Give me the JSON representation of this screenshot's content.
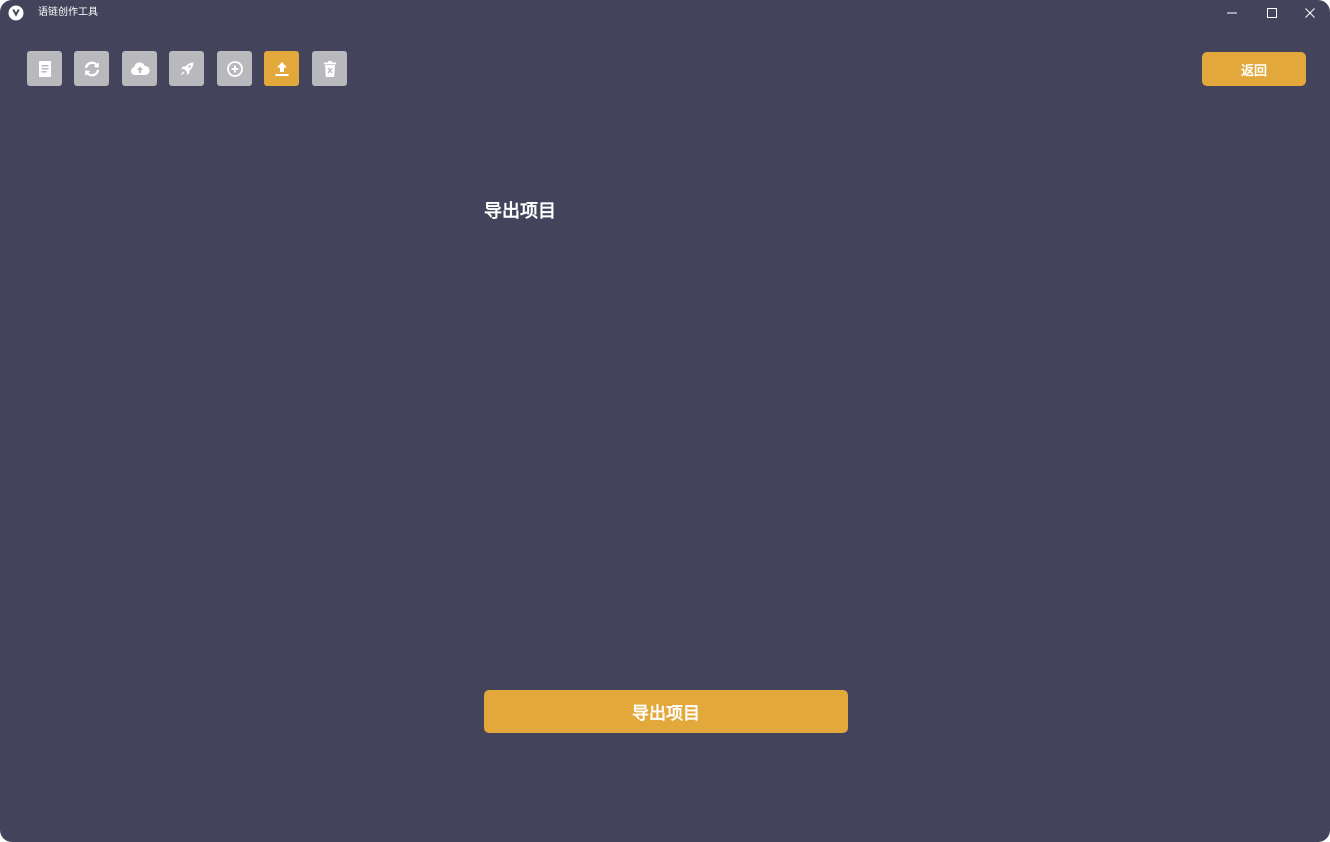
{
  "window": {
    "title": "语链创作工具"
  },
  "toolbar": {
    "tools": [
      {
        "name": "document",
        "icon": "document-icon",
        "active": false
      },
      {
        "name": "sync",
        "icon": "sync-icon",
        "active": false
      },
      {
        "name": "cloud-upload",
        "icon": "cloud-upload-icon",
        "active": false
      },
      {
        "name": "rocket",
        "icon": "rocket-icon",
        "active": false
      },
      {
        "name": "add",
        "icon": "plus-circle-icon",
        "active": false
      },
      {
        "name": "export",
        "icon": "upload-icon",
        "active": true
      },
      {
        "name": "delete",
        "icon": "trash-icon",
        "active": false
      }
    ],
    "back_label": "返回"
  },
  "main": {
    "section_title": "导出项目",
    "export_button_label": "导出项目"
  },
  "colors": {
    "background": "#43445b",
    "accent": "#e2a83b",
    "tool_inactive": "#b9b9bd",
    "text": "#ffffff"
  }
}
